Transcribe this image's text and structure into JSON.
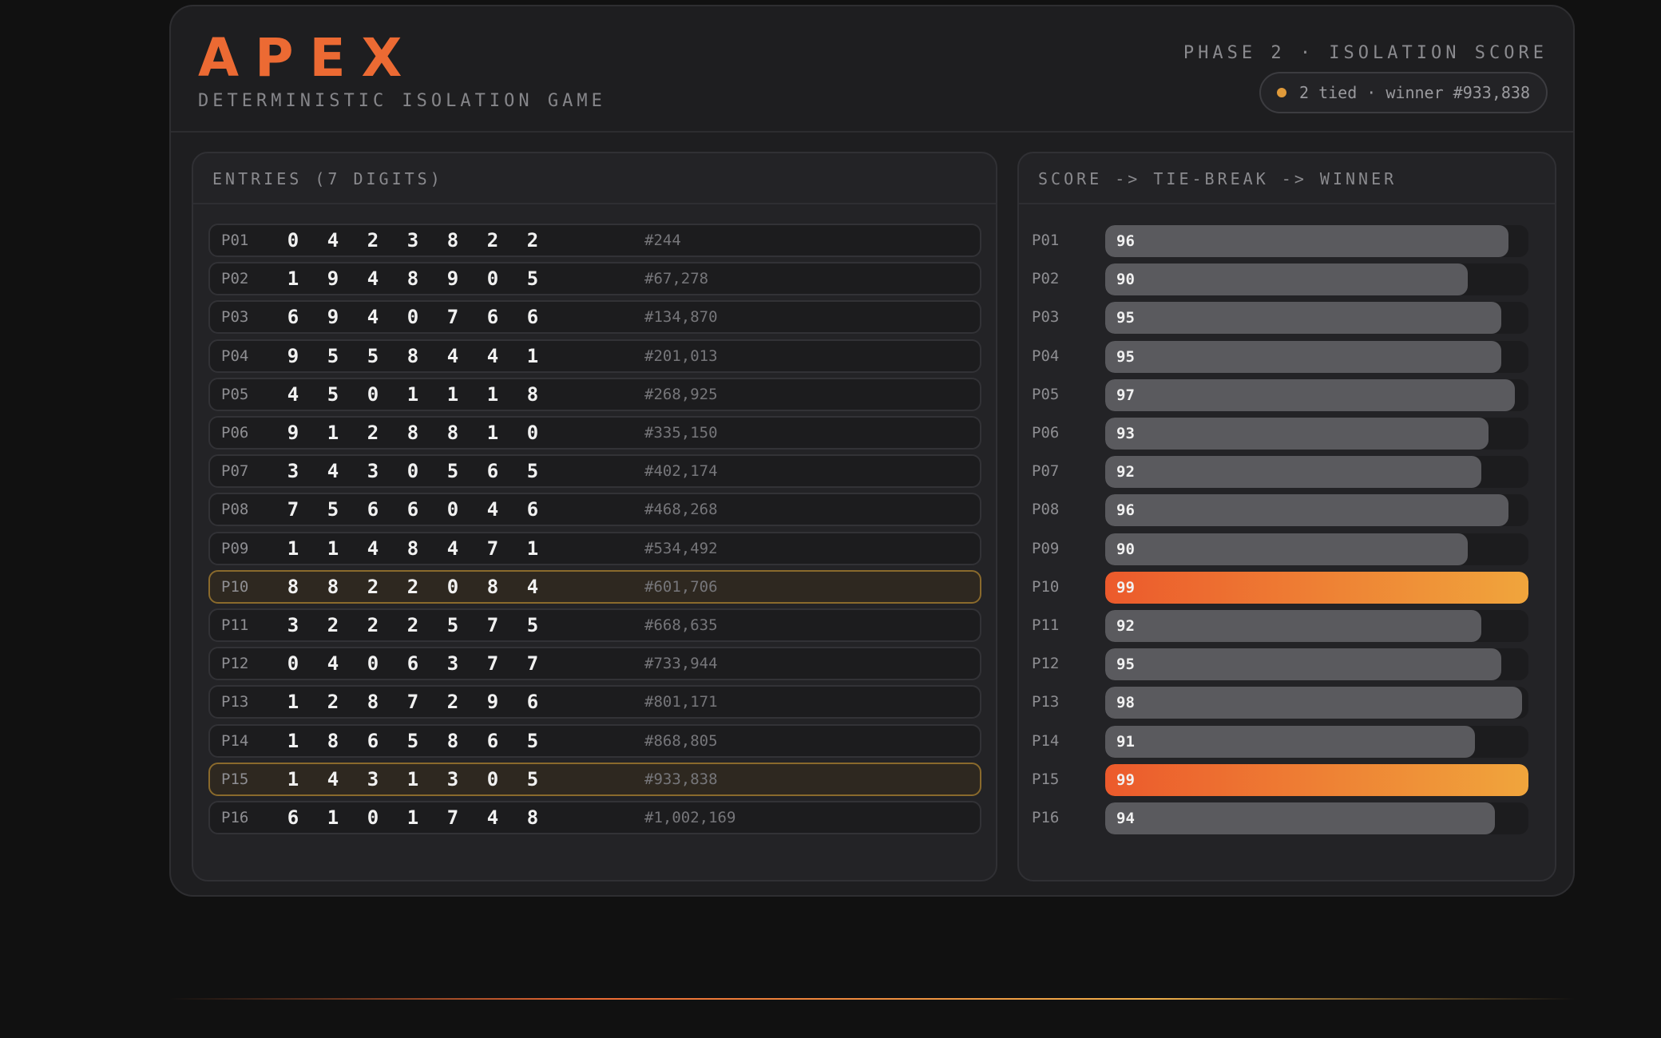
{
  "header": {
    "logo": "APEX",
    "subtitle": "DETERMINISTIC ISOLATION GAME",
    "phase": "PHASE 2 · ISOLATION SCORE",
    "status": "2 tied · winner #933,838"
  },
  "entries_panel": {
    "title": "ENTRIES (7 DIGITS)"
  },
  "score_panel": {
    "title": "SCORE -> TIE-BREAK -> WINNER"
  },
  "colors": {
    "accent": "#ec6a33",
    "accent_end": "#f0a53c",
    "tied_border": "#8a6a2c",
    "bar": "#5a5a5e"
  },
  "entries": [
    {
      "id": "P01",
      "digits": [
        "0",
        "4",
        "2",
        "3",
        "8",
        "2",
        "2"
      ],
      "rank": "#244",
      "tied": false
    },
    {
      "id": "P02",
      "digits": [
        "1",
        "9",
        "4",
        "8",
        "9",
        "0",
        "5"
      ],
      "rank": "#67,278",
      "tied": false
    },
    {
      "id": "P03",
      "digits": [
        "6",
        "9",
        "4",
        "0",
        "7",
        "6",
        "6"
      ],
      "rank": "#134,870",
      "tied": false
    },
    {
      "id": "P04",
      "digits": [
        "9",
        "5",
        "5",
        "8",
        "4",
        "4",
        "1"
      ],
      "rank": "#201,013",
      "tied": false
    },
    {
      "id": "P05",
      "digits": [
        "4",
        "5",
        "0",
        "1",
        "1",
        "1",
        "8"
      ],
      "rank": "#268,925",
      "tied": false
    },
    {
      "id": "P06",
      "digits": [
        "9",
        "1",
        "2",
        "8",
        "8",
        "1",
        "0"
      ],
      "rank": "#335,150",
      "tied": false
    },
    {
      "id": "P07",
      "digits": [
        "3",
        "4",
        "3",
        "0",
        "5",
        "6",
        "5"
      ],
      "rank": "#402,174",
      "tied": false
    },
    {
      "id": "P08",
      "digits": [
        "7",
        "5",
        "6",
        "6",
        "0",
        "4",
        "6"
      ],
      "rank": "#468,268",
      "tied": false
    },
    {
      "id": "P09",
      "digits": [
        "1",
        "1",
        "4",
        "8",
        "4",
        "7",
        "1"
      ],
      "rank": "#534,492",
      "tied": false
    },
    {
      "id": "P10",
      "digits": [
        "8",
        "8",
        "2",
        "2",
        "0",
        "8",
        "4"
      ],
      "rank": "#601,706",
      "tied": true
    },
    {
      "id": "P11",
      "digits": [
        "3",
        "2",
        "2",
        "2",
        "5",
        "7",
        "5"
      ],
      "rank": "#668,635",
      "tied": false
    },
    {
      "id": "P12",
      "digits": [
        "0",
        "4",
        "0",
        "6",
        "3",
        "7",
        "7"
      ],
      "rank": "#733,944",
      "tied": false
    },
    {
      "id": "P13",
      "digits": [
        "1",
        "2",
        "8",
        "7",
        "2",
        "9",
        "6"
      ],
      "rank": "#801,171",
      "tied": false
    },
    {
      "id": "P14",
      "digits": [
        "1",
        "8",
        "6",
        "5",
        "8",
        "6",
        "5"
      ],
      "rank": "#868,805",
      "tied": false
    },
    {
      "id": "P15",
      "digits": [
        "1",
        "4",
        "3",
        "1",
        "3",
        "0",
        "5"
      ],
      "rank": "#933,838",
      "tied": true
    },
    {
      "id": "P16",
      "digits": [
        "6",
        "1",
        "0",
        "1",
        "7",
        "4",
        "8"
      ],
      "rank": "#1,002,169",
      "tied": false
    }
  ],
  "scores": [
    {
      "id": "P01",
      "score": "96",
      "tied": false
    },
    {
      "id": "P02",
      "score": "90",
      "tied": false
    },
    {
      "id": "P03",
      "score": "95",
      "tied": false
    },
    {
      "id": "P04",
      "score": "95",
      "tied": false
    },
    {
      "id": "P05",
      "score": "97",
      "tied": false
    },
    {
      "id": "P06",
      "score": "93",
      "tied": false
    },
    {
      "id": "P07",
      "score": "92",
      "tied": false
    },
    {
      "id": "P08",
      "score": "96",
      "tied": false
    },
    {
      "id": "P09",
      "score": "90",
      "tied": false
    },
    {
      "id": "P10",
      "score": "99",
      "tied": true
    },
    {
      "id": "P11",
      "score": "92",
      "tied": false
    },
    {
      "id": "P12",
      "score": "95",
      "tied": false
    },
    {
      "id": "P13",
      "score": "98",
      "tied": false
    },
    {
      "id": "P14",
      "score": "91",
      "tied": false
    },
    {
      "id": "P15",
      "score": "99",
      "tied": true
    },
    {
      "id": "P16",
      "score": "94",
      "tied": false
    }
  ]
}
